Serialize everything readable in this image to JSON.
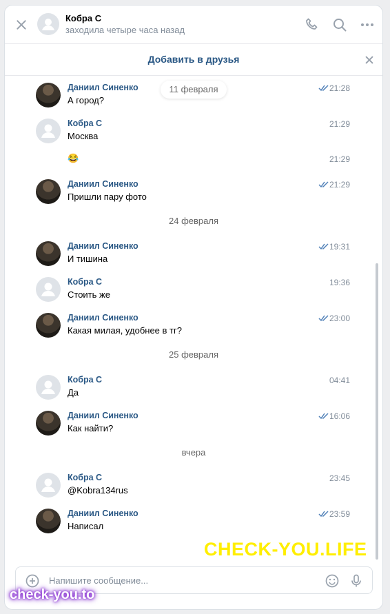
{
  "header": {
    "name": "Кобра С",
    "status": "заходила четыре часа назад"
  },
  "friend_bar": {
    "label": "Добавить в друзья"
  },
  "messages": [
    {
      "author": "Даниил Синенко",
      "text": "А город?",
      "time": "21:28",
      "read": true
    },
    {
      "author": "Кобра С",
      "text": "Москва",
      "time": "21:29",
      "read": false
    },
    {
      "author": "",
      "text": "😂",
      "time": "21:29",
      "read": false
    },
    {
      "author": "Даниил Синенко",
      "text": "Пришли пару фото",
      "time": "21:29",
      "read": true
    },
    {
      "author": "Даниил Синенко",
      "text": "И тишина",
      "time": "19:31",
      "read": true
    },
    {
      "author": "Кобра С",
      "text": "Стоить же",
      "time": "19:36",
      "read": false
    },
    {
      "author": "Даниил Синенко",
      "text": "Какая милая, удобнее в тг?",
      "time": "23:00",
      "read": true
    },
    {
      "author": "Кобра С",
      "text": "Да",
      "time": "04:41",
      "read": false
    },
    {
      "author": "Даниил Синенко",
      "text": "Как найти?",
      "time": "16:06",
      "read": true
    },
    {
      "author": "Кобра С",
      "text": "@Kobra134rus",
      "time": "23:45",
      "read": false
    },
    {
      "author": "Даниил Синенко",
      "text": "Написал",
      "time": "23:59",
      "read": true
    }
  ],
  "dates": [
    "11 февраля",
    "24 февраля",
    "25 февраля",
    "вчера"
  ],
  "composer": {
    "placeholder": "Напишите сообщение..."
  },
  "watermarks": {
    "top": "CHECK-YOU.LIFE",
    "bottom": "check-you.to"
  },
  "colors": {
    "link": "#2a5885",
    "muted": "#818c99",
    "accent": "#4a76a8"
  },
  "icons": [
    "close-icon",
    "phone-icon",
    "search-icon",
    "more-icon",
    "read-check-icon",
    "add-attachment-icon",
    "smile-icon",
    "mic-icon"
  ]
}
